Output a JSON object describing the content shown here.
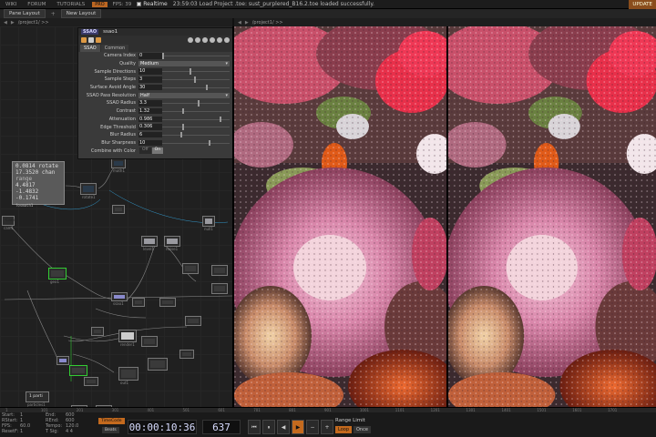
{
  "menu": {
    "items": [
      "WIKI",
      "FORUM",
      "TUTORIALS"
    ],
    "fps_badge": "PRO",
    "fps_label": "FPS: 39",
    "realtime": "Realtime",
    "log": "23:59:03 Load Project .toe: sust_purplered_B16.2.toe loaded successfully.",
    "update": "UPDATE"
  },
  "tabs": {
    "pane_layout": "Pane Layout",
    "new_layout": "New Layout"
  },
  "path": {
    "left": "/project1/ >>",
    "right": "/project1/ >>"
  },
  "dialog": {
    "type": "SSAO",
    "name": "ssao1",
    "tabs": [
      "SSAO",
      "Common"
    ],
    "params": [
      {
        "label": "Camera Index",
        "value": "0",
        "kind": "slider",
        "pos": 0.0
      },
      {
        "label": "Quality",
        "value": "Medium",
        "kind": "menu"
      },
      {
        "label": "Sample Directions",
        "value": "10",
        "kind": "slider",
        "pos": 0.42
      },
      {
        "label": "Sample Steps",
        "value": "3",
        "kind": "slider",
        "pos": 0.5
      },
      {
        "label": "Surface Avoid Angle",
        "value": "30",
        "kind": "slider",
        "pos": 0.68
      },
      {
        "label": "SSAO Pass Resolution",
        "value": "Half",
        "kind": "menu"
      },
      {
        "label": "SSAO Radius",
        "value": "3.3",
        "kind": "slider",
        "pos": 0.55
      },
      {
        "label": "Contrast",
        "value": "1.32",
        "kind": "slider",
        "pos": 0.32
      },
      {
        "label": "Attenuation",
        "value": "0.986",
        "kind": "slider",
        "pos": 0.9
      },
      {
        "label": "Edge Threshold",
        "value": "0.306",
        "kind": "slider",
        "pos": 0.32
      },
      {
        "label": "Blur Radius",
        "value": "6",
        "kind": "slider",
        "pos": 0.28
      },
      {
        "label": "Blur Sharpness",
        "value": "10",
        "kind": "slider",
        "pos": 0.72
      },
      {
        "label": "Combine with Color",
        "value": "",
        "kind": "toggle",
        "options": [
          "Off",
          "On"
        ],
        "on": 1
      }
    ]
  },
  "math_panel": {
    "lines": [
      "0.0814 rotate",
      "17.3520 chan",
      "      range",
      "4.4817",
      "-1.4832",
      "-0.1741"
    ],
    "name": "fosmath1"
  },
  "network_nodes": [
    {
      "title": "",
      "label": "rotate1",
      "kind": "chop"
    },
    {
      "title": "",
      "label": "math1",
      "kind": "chop"
    },
    {
      "title": "Cam",
      "label": "cam1",
      "kind": "gray"
    },
    {
      "title": "",
      "label": "null1",
      "kind": "gray"
    },
    {
      "title": "",
      "label": "level1",
      "kind": "gray"
    },
    {
      "title": "",
      "label": "noise1",
      "kind": "gray"
    },
    {
      "title": "",
      "label": "geo1",
      "kind": "dark"
    },
    {
      "title": "",
      "label": "ssao1",
      "kind": "dark"
    },
    {
      "title": "",
      "label": "render1",
      "kind": "dark"
    },
    {
      "title": "",
      "label": "out1",
      "kind": "dark"
    },
    {
      "title": "1 parti",
      "label": "particles1",
      "kind": "dark"
    }
  ],
  "timeline": {
    "ruler": [
      "1",
      "101",
      "201",
      "301",
      "401",
      "501",
      "601",
      "701",
      "801",
      "901",
      "1001",
      "1101",
      "1201",
      "1301",
      "1401",
      "1501",
      "1601",
      "1701"
    ],
    "info": {
      "start_label": "Start:",
      "start": "1",
      "end_label": "End:",
      "end": "600",
      "rstart_label": "RStart:",
      "rstart": "1",
      "rend_label": "REnd:",
      "rend": "600",
      "fps_label": "FPS:",
      "fps": "60.0",
      "tempo_label": "Tempo:",
      "tempo": "120.0",
      "resetf_label": "ResetF:",
      "resetf": "1",
      "tsig_label": "T Sig:",
      "tsig": "4  4"
    },
    "timecode_btn": "TimeCode",
    "beats_btn": "Beats",
    "timecode": "00:00:10:36",
    "frame": "637",
    "range_label": "Range Limit",
    "range_opts": [
      "Loop",
      "Once"
    ]
  }
}
